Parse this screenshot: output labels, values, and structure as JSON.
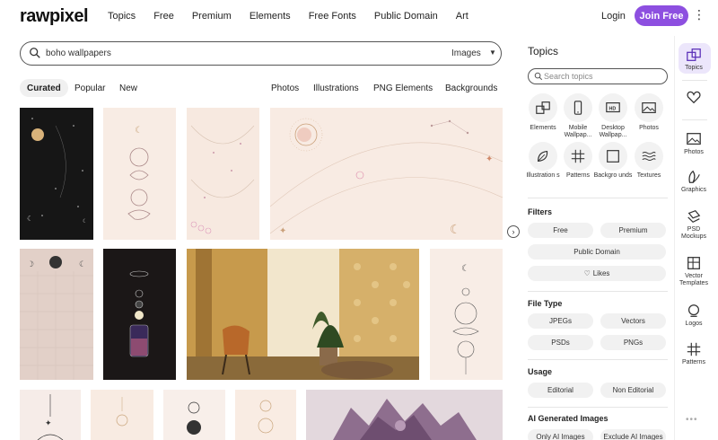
{
  "header": {
    "logo": "rawpixel",
    "nav": [
      "Topics",
      "Free",
      "Premium",
      "Elements",
      "Free Fonts",
      "Public Domain",
      "Art"
    ],
    "login": "Login",
    "join": "Join Free"
  },
  "search": {
    "query": "boho wallpapers",
    "type": "Images"
  },
  "sort": {
    "curated": "Curated",
    "popular": "Popular",
    "new": "New"
  },
  "types": {
    "photos": "Photos",
    "illustrations": "Illustrations",
    "png": "PNG Elements",
    "backgrounds": "Backgrounds"
  },
  "panel": {
    "title": "Topics",
    "search_placeholder": "Search topics",
    "topics": [
      {
        "label": "Elements",
        "icon": "elements-icon"
      },
      {
        "label": "Mobile Wallpap...",
        "icon": "mobile-icon"
      },
      {
        "label": "Desktop Wallpap...",
        "icon": "desktop-hd-icon"
      },
      {
        "label": "Photos",
        "icon": "photo-icon"
      },
      {
        "label": "Illustration s",
        "icon": "leaf-icon"
      },
      {
        "label": "Patterns",
        "icon": "grid-icon"
      },
      {
        "label": "Backgro unds",
        "icon": "square-icon"
      },
      {
        "label": "Textures",
        "icon": "waves-icon"
      }
    ],
    "filters_title": "Filters",
    "filters": {
      "free": "Free",
      "premium": "Premium",
      "public_domain": "Public Domain",
      "likes": "Likes"
    },
    "filetype_title": "File Type",
    "filetypes": {
      "jpegs": "JPEGs",
      "vectors": "Vectors",
      "psds": "PSDs",
      "pngs": "PNGs"
    },
    "usage_title": "Usage",
    "usage": {
      "editorial": "Editorial",
      "non_editorial": "Non Editorial"
    },
    "ai_title": "AI Generated Images",
    "ai": {
      "only": "Only AI Images",
      "exclude": "Exclude AI Images"
    }
  },
  "rail": [
    {
      "label": "Topics",
      "icon": "topics-icon"
    },
    {
      "label": "",
      "icon": "heart-icon"
    },
    {
      "label": "Photos",
      "icon": "photo-icon"
    },
    {
      "label": "Graphics",
      "icon": "graphics-icon"
    },
    {
      "label": "PSD Mockups",
      "icon": "psd-icon"
    },
    {
      "label": "Vector Templates",
      "icon": "vector-icon"
    },
    {
      "label": "Logos",
      "icon": "logo-icon"
    },
    {
      "label": "Patterns",
      "icon": "pattern-icon"
    }
  ],
  "colors": {
    "accent": "#8d4fe0",
    "active_bg": "#ece6fb"
  }
}
